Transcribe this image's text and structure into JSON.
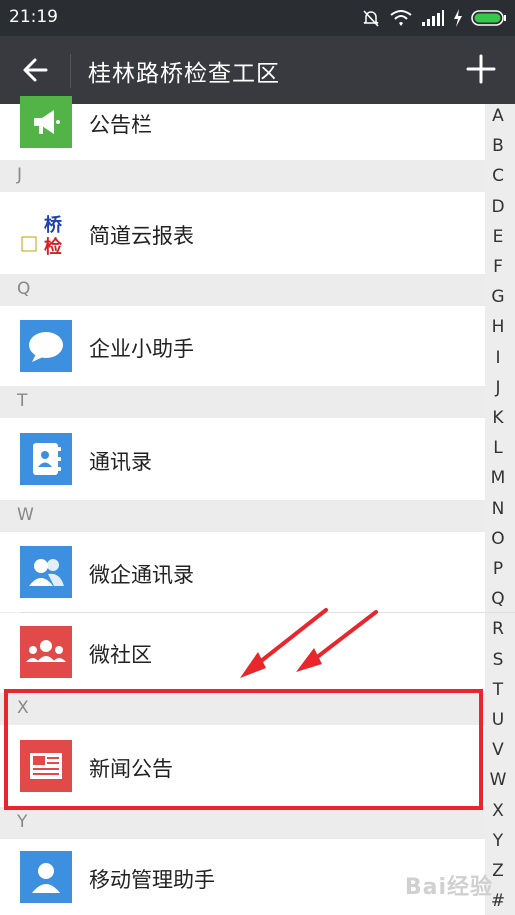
{
  "status": {
    "time": "21:19"
  },
  "appbar": {
    "title": "桂林路桥检查工区"
  },
  "rows": [
    {
      "label": "公告栏"
    },
    {
      "label": "简道云报表"
    },
    {
      "label": "企业小助手"
    },
    {
      "label": "通讯录"
    },
    {
      "label": "微企通讯录"
    },
    {
      "label": "微社区"
    },
    {
      "label": "新闻公告"
    },
    {
      "label": "移动管理助手"
    }
  ],
  "sections": [
    "J",
    "Q",
    "T",
    "W",
    "X",
    "Y"
  ],
  "logo_text": [
    "桥",
    "检"
  ],
  "index_letters": [
    "A",
    "B",
    "C",
    "D",
    "E",
    "F",
    "G",
    "H",
    "I",
    "J",
    "K",
    "L",
    "M",
    "N",
    "O",
    "P",
    "Q",
    "R",
    "S",
    "T",
    "U",
    "V",
    "W",
    "X",
    "Y",
    "Z",
    "#"
  ],
  "watermark": "Bai经验",
  "colors": {
    "statusbar": "#2a2d31",
    "appbar": "#393a3f",
    "green_icon": "#52b446",
    "blue_icon": "#3d8fdf",
    "red_icon": "#e24a4a",
    "highlight": "#e8262b"
  },
  "icons": [
    "megaphone-icon",
    "report-logo-icon",
    "chat-bubble-icon",
    "contacts-book-icon",
    "group-icon",
    "community-icon",
    "news-icon",
    "person-icon"
  ]
}
